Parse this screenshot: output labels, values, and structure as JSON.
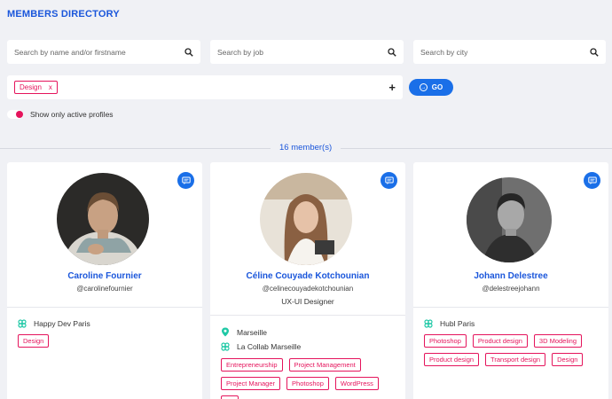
{
  "page": {
    "title": "MEMBERS DIRECTORY"
  },
  "search": {
    "name_placeholder": "Search by name and/or firstname",
    "job_placeholder": "Search by job",
    "city_placeholder": "Search by city"
  },
  "filter": {
    "chip_label": "Design",
    "chip_remove": "x",
    "add_label": "+",
    "go_label": "GO"
  },
  "toggle": {
    "label": "Show only active profiles"
  },
  "results": {
    "count_label": "16 member(s)"
  },
  "colors": {
    "accent": "#1a56db",
    "button": "#1a6fe8",
    "tag": "#e5145c",
    "location": "#1ec8a5"
  },
  "members": [
    {
      "name": "Caroline Fournier",
      "handle": "@carolinefournier",
      "job": "",
      "location": "",
      "community": "Happy Dev Paris",
      "tags": [
        "Design"
      ]
    },
    {
      "name": "Céline Couyade Kotchounian",
      "handle": "@celinecouyadekotchounian",
      "job": "UX-UI Designer",
      "location": "Marseille",
      "community": "La Collab Marseille",
      "tags": [
        "Entrepreneurship",
        "Project Management",
        "Project Manager",
        "Photoshop",
        "WordPress",
        "UI"
      ]
    },
    {
      "name": "Johann Delestree",
      "handle": "@delestreejohann",
      "job": "",
      "location": "",
      "community": "Hubl Paris",
      "tags": [
        "Photoshop",
        "Product design",
        "3D Modeling",
        "Product design",
        "Transport design",
        "Design"
      ]
    }
  ]
}
